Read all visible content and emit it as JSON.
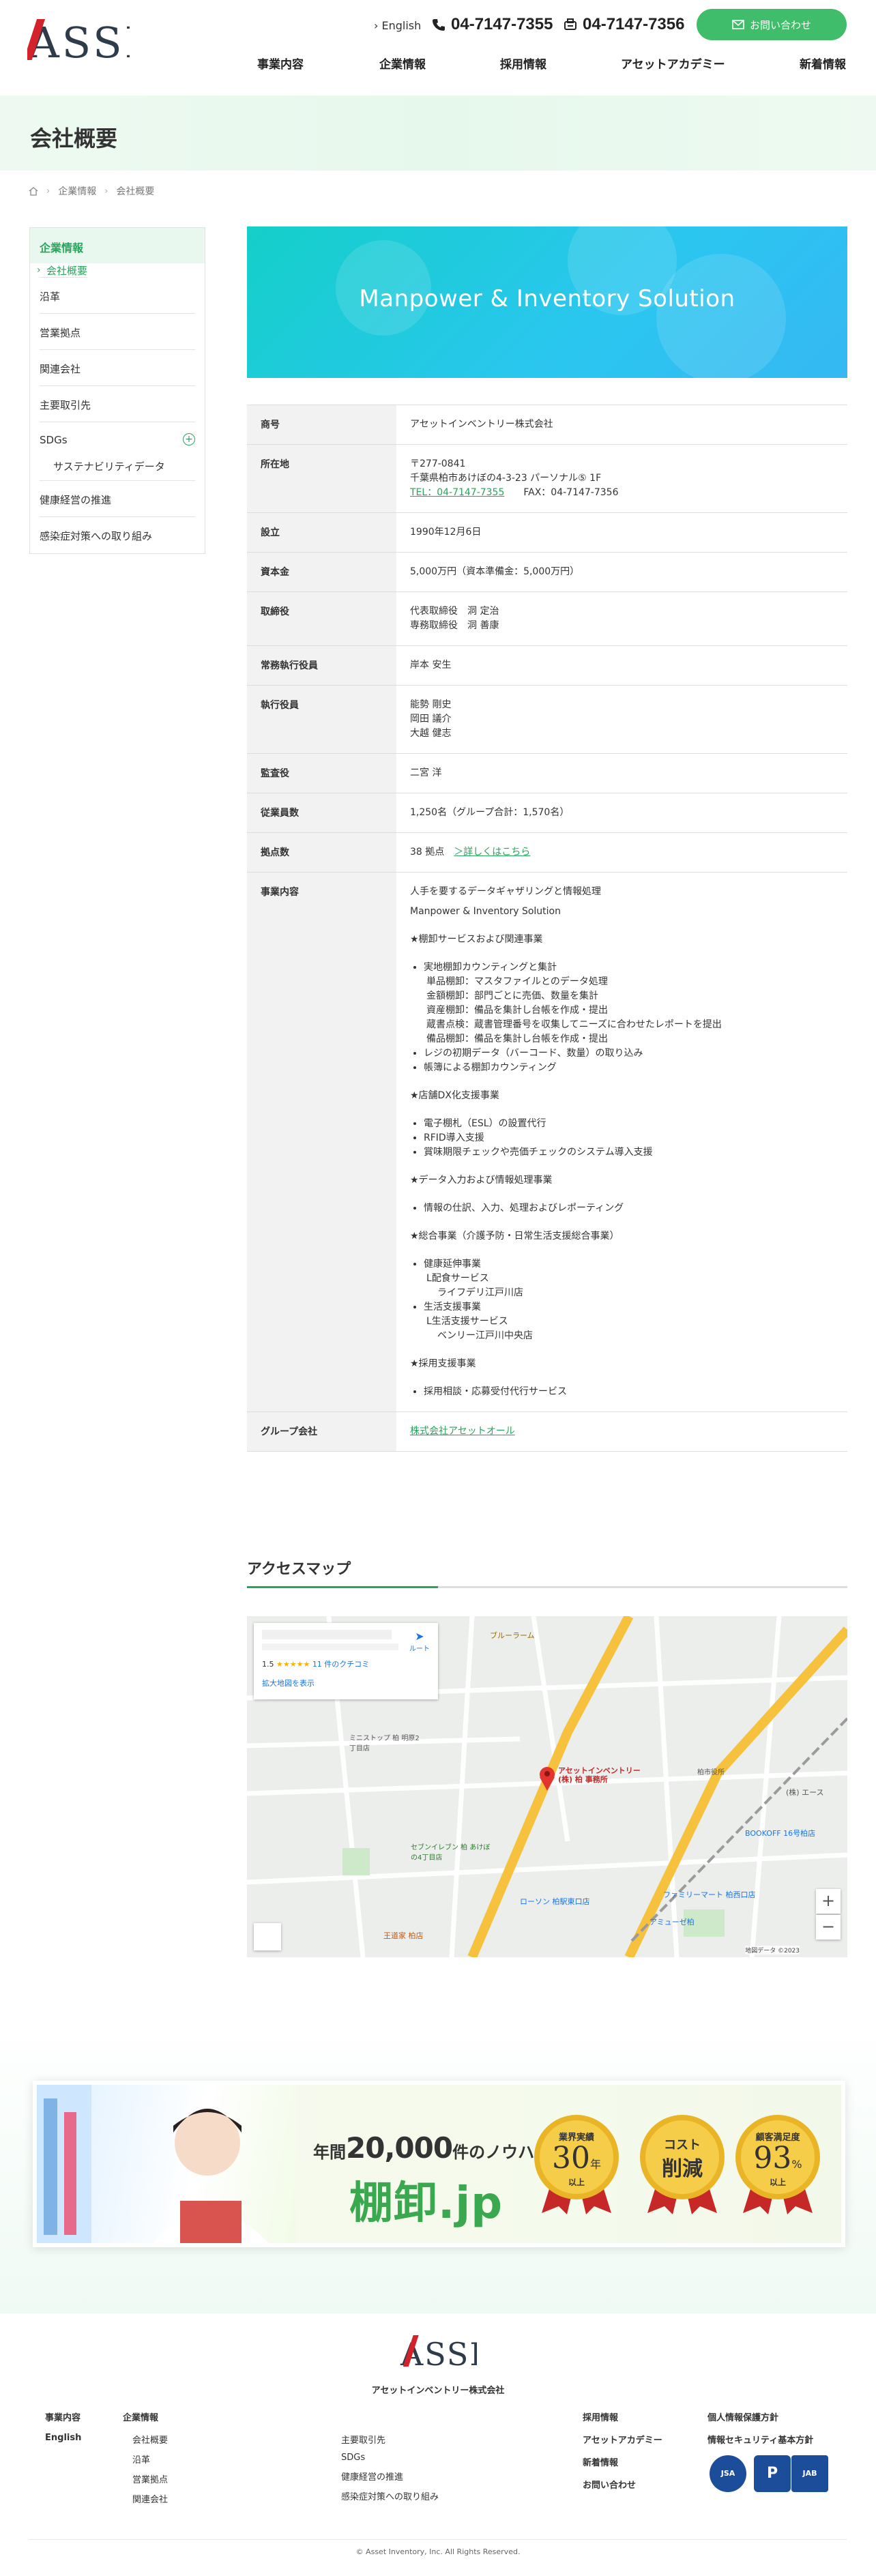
{
  "header": {
    "logo_text": "ASSET",
    "lang_link": "English",
    "tel": "04-7147-7355",
    "fax": "04-7147-7356",
    "contact_button": "お問い合わせ",
    "nav": [
      "事業内容",
      "企業情報",
      "採用情報",
      "アセットアカデミー",
      "新着情報"
    ]
  },
  "page": {
    "title": "会社概要",
    "breadcrumb": [
      "企業情報",
      "会社概要"
    ]
  },
  "sidebar": {
    "heading": "企業情報",
    "items": [
      {
        "label": "会社概要",
        "active": true
      },
      {
        "label": "沿革"
      },
      {
        "label": "営業拠点"
      },
      {
        "label": "関連会社"
      },
      {
        "label": "主要取引先"
      },
      {
        "label": "SDGs"
      },
      {
        "label": "サステナビリティデータ",
        "sub": true
      },
      {
        "label": "健康経営の推進"
      },
      {
        "label": "感染症対策への取り組み"
      }
    ]
  },
  "hero": {
    "text": "Manpower & Inventory Solution"
  },
  "company": {
    "rows": [
      {
        "th": "商号",
        "lines": [
          "アセットインベントリー株式会社"
        ]
      },
      {
        "th": "所在地",
        "lines": [
          "〒277-0841",
          "千葉県柏市あけぼの4-3-23 パーソナル⑤ 1F"
        ],
        "tel": "TEL：04-7147-7355",
        "fax": "FAX：04-7147-7356"
      },
      {
        "th": "設立",
        "lines": [
          "1990年12月6日"
        ]
      },
      {
        "th": "資本金",
        "lines": [
          "5,000万円（資本準備金：5,000万円）"
        ]
      },
      {
        "th": "取締役",
        "lines": [
          "代表取締役　洞 定治",
          "専務取締役　洞 善康"
        ]
      },
      {
        "th": "常務執行役員",
        "lines": [
          "岸本 安生"
        ]
      },
      {
        "th": "執行役員",
        "lines": [
          "能勢 剛史",
          "岡田 議介",
          "大越 健志"
        ]
      },
      {
        "th": "監査役",
        "lines": [
          "二宮 洋"
        ]
      },
      {
        "th": "従業員数",
        "lines": [
          "1,250名（グループ合計：1,570名）"
        ]
      },
      {
        "th": "拠点数",
        "lines": [
          "38 拠点"
        ],
        "link": "＞詳しくはこちら"
      },
      {
        "th": "事業内容"
      },
      {
        "th": "グループ会社",
        "link": "株式会社アセットオール"
      }
    ],
    "business": {
      "intro": [
        "人手を要するデータギャザリングと情報処理",
        "Manpower & Inventory Solution"
      ],
      "sec1": "★棚卸サービスおよび関連事業",
      "sec1_items": [
        "実地棚卸カウンティングと集計"
      ],
      "sec1_sub": [
        "単品棚卸：マスタファイルとのデータ処理",
        "金額棚卸：部門ごとに売価、数量を集計",
        "資産棚卸：備品を集計し台帳を作成・提出",
        "蔵書点検：蔵書管理番号を収集してニーズに合わせたレポートを提出",
        "備品棚卸：備品を集計し台帳を作成・提出"
      ],
      "sec1_items2": [
        "レジの初期データ（バーコード、数量）の取り込み",
        "帳簿による棚卸カウンティング"
      ],
      "sec2": "★店舗DX化支援事業",
      "sec2_items": [
        "電子棚札（ESL）の設置代行",
        "RFID導入支援",
        "賞味期限チェックや売価チェックのシステム導入支援"
      ],
      "sec3": "★データ入力および情報処理事業",
      "sec3_items": [
        "情報の仕訳、入力、処理およびレポーティング"
      ],
      "sec4": "★総合事業（介護予防・日常生活支援総合事業）",
      "sec4_a": "健康延伸事業",
      "sec4_a1": "L配食サービス",
      "sec4_a2": "ライフデリ江戸川店",
      "sec4_b": "生活支援事業",
      "sec4_b1": "L生活支援サービス",
      "sec4_b2": "ベンリー江戸川中央店",
      "sec5": "★採用支援事業",
      "sec5_items": [
        "採用相談・応募受付代行サービス"
      ]
    }
  },
  "access": {
    "heading": "アクセスマップ",
    "map_rating": "1.5",
    "map_reviews": "11 件のクチコミ",
    "map_link": "拡大地図を表示",
    "map_directions": "ルート",
    "pin_label": "アセットインベントリー(株) 柏 事務所",
    "places": [
      "ブルーラーム",
      "ミニストップ 柏 明原2丁目店",
      "セブンイレブン 柏 あけぼの4丁目店",
      "(株) エース",
      "BOOKOFF 16号柏店",
      "ファミリーマート 柏西口店",
      "ローソン 柏駅東口店",
      "アミューゼ柏",
      "王道家 柏店",
      "柏市役所"
    ],
    "map_copyright": "地図データ ©2023"
  },
  "banner": {
    "prefix": "年間",
    "number": "20,000",
    "suffix": "件のノウハウ",
    "brand": "棚卸.jp",
    "medals": [
      {
        "top": "業界実績",
        "big": "30",
        "unit": "年",
        "bottom": "以上"
      },
      {
        "top": "コスト",
        "big": "削減",
        "unit": "",
        "bottom": ""
      },
      {
        "top": "顧客満足度",
        "big": "93",
        "unit": "%",
        "bottom": "以上"
      }
    ]
  },
  "footer": {
    "logo_text": "ASSET",
    "company_name": "アセットインベントリー株式会社",
    "col1": [
      "事業内容",
      "English"
    ],
    "col2_head": "企業情報",
    "col2": [
      "会社概要",
      "沿革",
      "営業拠点",
      "関連会社"
    ],
    "col3": [
      "主要取引先",
      "SDGs",
      "健康経営の推進",
      "感染症対策への取り組み"
    ],
    "col4": [
      "採用情報",
      "アセットアカデミー",
      "新着情報",
      "お問い合わせ"
    ],
    "col5": [
      "個人情報保護方針",
      "情報セキュリティ基本方針"
    ],
    "badges": [
      "JSA",
      "P",
      "JAB"
    ],
    "copyright": "© Asset Inventory, Inc. All Rights Reserved."
  },
  "colors": {
    "accent": "#2aa35d",
    "button": "#3fbd6a",
    "hero": "#19cbd7"
  }
}
